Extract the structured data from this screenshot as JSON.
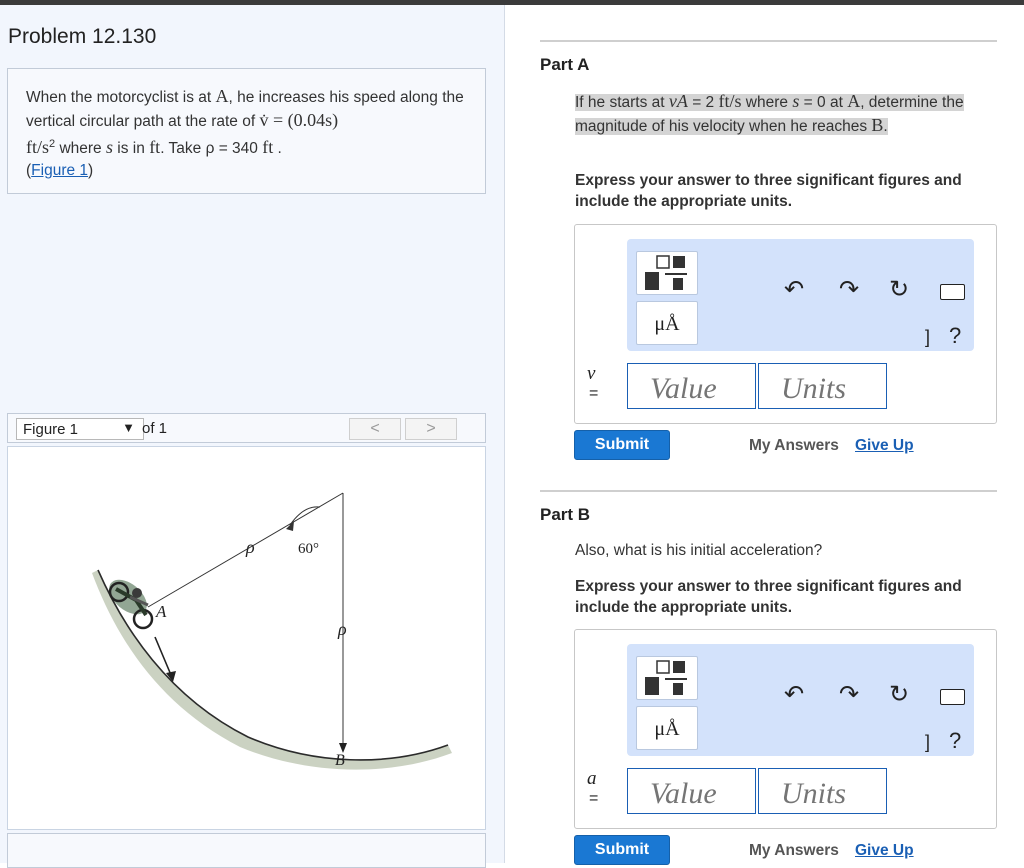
{
  "problem": {
    "title": "Problem 12.130",
    "text_1": "When the motorcyclist is at ",
    "point_a": "A",
    "text_2": ", he increases his speed along the vertical circular path at the rate of ",
    "rate_expr": "v̇ = (0.04s)",
    "rate_unit": "ft/s",
    "rate_exp": "2",
    "text_3": " where ",
    "s_var": "s",
    "text_4": " is in ",
    "ft_unit": "ft",
    "text_5": ". Take ",
    "rho_expr": "ρ = 340",
    "rho_unit": "ft",
    "text_6": " .",
    "figure_link_open": "(",
    "figure_link": "Figure 1",
    "figure_link_close": ")"
  },
  "figure": {
    "select_value": "Figure 1",
    "select_arrow": "▼",
    "of_label": "of 1",
    "prev_label": "<",
    "next_label": ">",
    "labels": {
      "rho_1": "ρ",
      "angle": "60°",
      "point_a": "A",
      "rho_2": "ρ",
      "point_b": "B"
    }
  },
  "part_a": {
    "title": "Part A",
    "prompt_1": "If he starts at ",
    "va": "vA",
    "prompt_2": " = 2 ",
    "unit": "ft/s",
    "prompt_3": " where ",
    "s_var": "s",
    "prompt_4": " = 0 at ",
    "point_a": "A",
    "prompt_5": ", determine the magnitude of his velocity when he reaches ",
    "point_b": "B",
    "prompt_6": ".",
    "instruction": "Express your answer to three significant figures and include the appropriate units.",
    "variable": "v",
    "equals": "=",
    "value_placeholder": "Value",
    "units_placeholder": "Units",
    "submit": "Submit",
    "my_answers": "My Answers",
    "give_up": "Give Up"
  },
  "part_b": {
    "title": "Part B",
    "prompt": "Also, what is his initial acceleration?",
    "instruction": "Express your answer to three significant figures and include the appropriate units.",
    "variable": "a",
    "equals": "=",
    "value_placeholder": "Value",
    "units_placeholder": "Units",
    "submit": "Submit",
    "my_answers": "My Answers",
    "give_up": "Give Up"
  },
  "toolbar": {
    "mu_button": "μÅ",
    "bracket": "]",
    "help": "?",
    "undo_icon": "undo-arrow",
    "redo_icon": "redo-arrow",
    "reset_icon": "circular-reset-arrow",
    "keyboard_icon": "keyboard"
  }
}
